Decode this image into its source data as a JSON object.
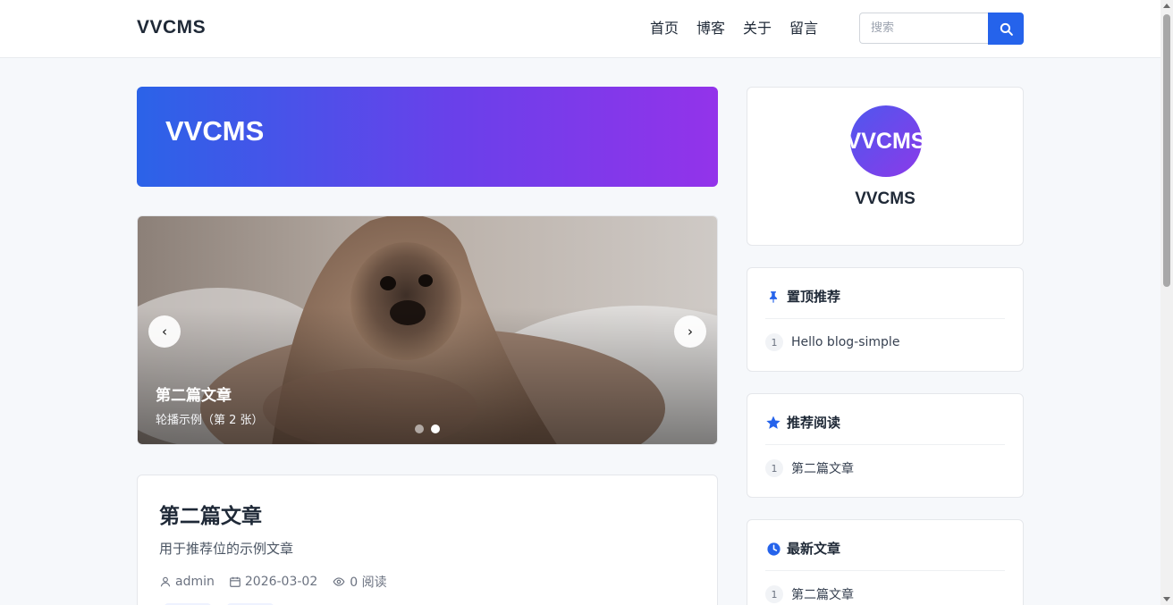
{
  "header": {
    "brand": "VVCMS",
    "nav": [
      "首页",
      "博客",
      "关于",
      "留言"
    ],
    "search_placeholder": "搜索"
  },
  "hero": {
    "title": "VVCMS"
  },
  "carousel": {
    "slide_title": "第二篇文章",
    "slide_subtitle": "轮播示例（第 2 张）",
    "prev_label": "‹",
    "next_label": "›",
    "slide_count": 2,
    "active_slide": 2
  },
  "post": {
    "title": "第二篇文章",
    "excerpt": "用于推荐位的示例文章",
    "author": "admin",
    "date": "2026-03-02",
    "views": "0 阅读"
  },
  "sidebar": {
    "profile_name": "VVCMS",
    "avatar_text": "VVCMS",
    "pinned": {
      "title": "置顶推荐",
      "items": [
        {
          "num": "1",
          "text": "Hello blog-simple"
        }
      ]
    },
    "recommended": {
      "title": "推荐阅读",
      "items": [
        {
          "num": "1",
          "text": "第二篇文章"
        }
      ]
    },
    "latest": {
      "title": "最新文章",
      "items": [
        {
          "num": "1",
          "text": "第二篇文章"
        }
      ]
    }
  },
  "colors": {
    "accent": "#2563eb",
    "gradient_start": "#2b63e8",
    "gradient_end": "#9333ea"
  },
  "icons": [
    "search-icon",
    "pin-icon",
    "star-icon",
    "clock-icon",
    "user-icon",
    "calendar-icon",
    "eye-icon"
  ]
}
